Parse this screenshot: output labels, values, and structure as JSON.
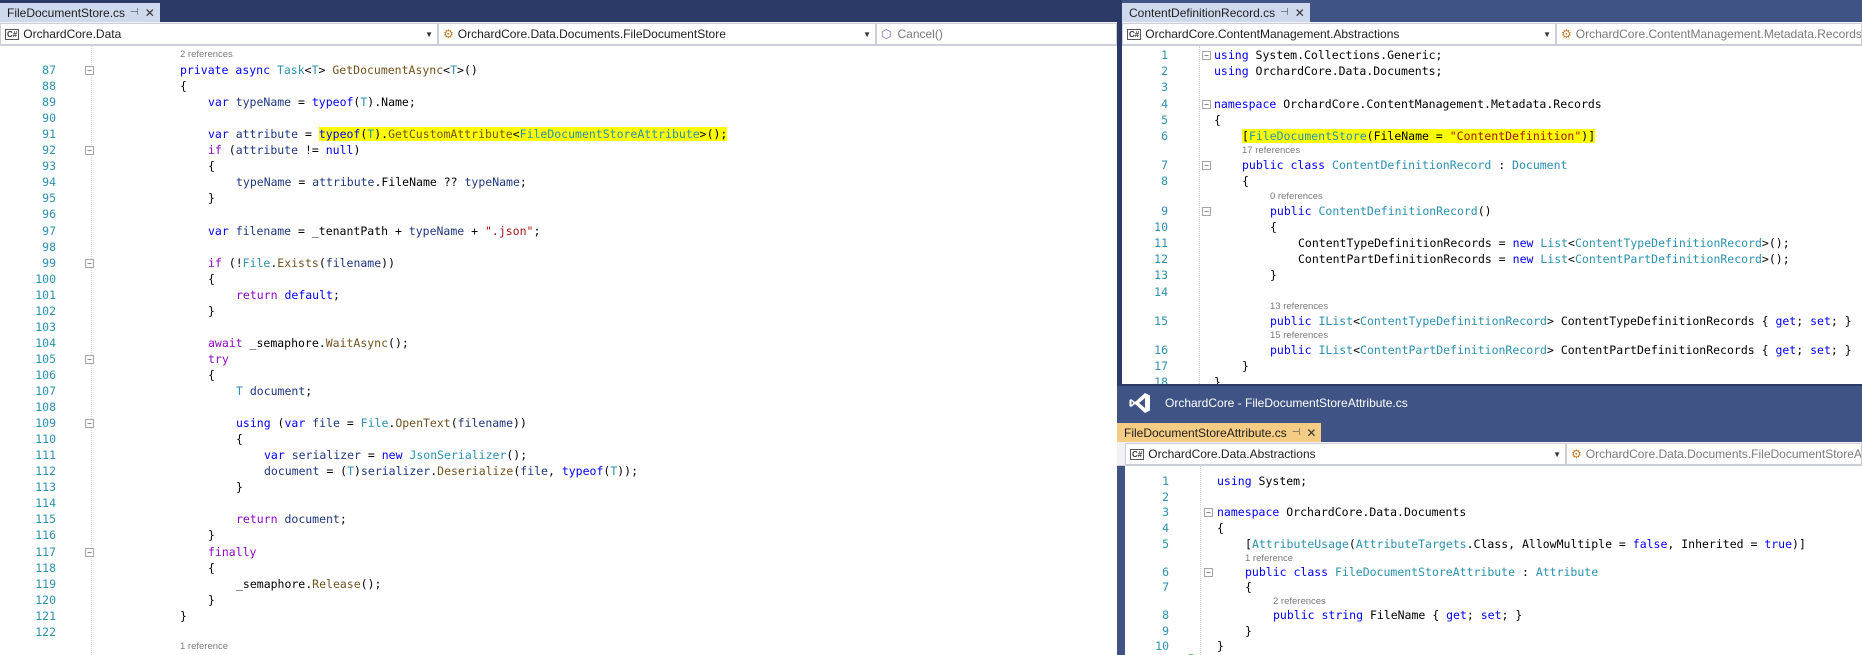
{
  "left": {
    "tab": {
      "label": "FileDocumentStore.cs"
    },
    "nav": {
      "project": "OrchardCore.Data",
      "type": "OrchardCore.Data.Documents.FileDocumentStore",
      "member": "Cancel()"
    },
    "lines": [
      {
        "ref": "2 references"
      },
      {
        "n": "87",
        "fold": "-",
        "ind": 1,
        "t": [
          [
            "kw",
            "private "
          ],
          [
            "kw",
            "async "
          ],
          [
            "ty",
            "Task"
          ],
          [
            "",
            "<"
          ],
          [
            "ty",
            "T"
          ],
          [
            "",
            "> "
          ],
          [
            "mth",
            "GetDocumentAsync"
          ],
          [
            "",
            "<"
          ],
          [
            "ty",
            "T"
          ],
          [
            "",
            ">()"
          ]
        ]
      },
      {
        "n": "88",
        "ind": 1,
        "t": [
          [
            "",
            "{"
          ]
        ]
      },
      {
        "n": "89",
        "ind": 2,
        "t": [
          [
            "kw",
            "var "
          ],
          [
            "prm",
            "typeName"
          ],
          [
            "",
            " = "
          ],
          [
            "kw",
            "typeof"
          ],
          [
            "",
            "("
          ],
          [
            "ty",
            "T"
          ],
          [
            "",
            ").Name;"
          ]
        ]
      },
      {
        "n": "90"
      },
      {
        "n": "91",
        "ind": 2,
        "t": [
          [
            "kw",
            "var "
          ],
          [
            "prm",
            "attribute"
          ],
          [
            "",
            " = "
          ],
          [
            "kw yl",
            "typeof"
          ],
          [
            "yl",
            "("
          ],
          [
            "ty yl",
            "T"
          ],
          [
            "yl",
            ")."
          ],
          [
            "mth yl",
            "GetCustomAttribute"
          ],
          [
            "yl",
            "<"
          ],
          [
            "ty yl",
            "FileDocumentStoreAttribute"
          ],
          [
            "yl",
            ">();"
          ]
        ]
      },
      {
        "n": "92",
        "fold": "-",
        "ind": 2,
        "t": [
          [
            "ctl",
            "if "
          ],
          [
            "",
            "("
          ],
          [
            "prm",
            "attribute"
          ],
          [
            "",
            " != "
          ],
          [
            "kw",
            "null"
          ],
          [
            "",
            ")"
          ]
        ]
      },
      {
        "n": "93",
        "ind": 2,
        "t": [
          [
            "",
            "{"
          ]
        ]
      },
      {
        "n": "94",
        "ind": 3,
        "t": [
          [
            "prm",
            "typeName"
          ],
          [
            "",
            " = "
          ],
          [
            "prm",
            "attribute"
          ],
          [
            "",
            ".FileName ?? "
          ],
          [
            "prm",
            "typeName"
          ],
          [
            "",
            ";"
          ]
        ]
      },
      {
        "n": "95",
        "ind": 2,
        "t": [
          [
            "",
            "}"
          ]
        ]
      },
      {
        "n": "96"
      },
      {
        "n": "97",
        "ind": 2,
        "t": [
          [
            "kw",
            "var "
          ],
          [
            "prm",
            "filename"
          ],
          [
            "",
            " = _tenantPath + "
          ],
          [
            "prm",
            "typeName"
          ],
          [
            "",
            " + "
          ],
          [
            "st",
            "\".json\""
          ],
          [
            "",
            ";"
          ]
        ]
      },
      {
        "n": "98"
      },
      {
        "n": "99",
        "fold": "-",
        "ind": 2,
        "t": [
          [
            "ctl",
            "if "
          ],
          [
            "",
            "(!"
          ],
          [
            "ty",
            "File"
          ],
          [
            "",
            "."
          ],
          [
            "mth",
            "Exists"
          ],
          [
            "",
            "("
          ],
          [
            "prm",
            "filename"
          ],
          [
            "",
            "))"
          ]
        ]
      },
      {
        "n": "100",
        "ind": 2,
        "t": [
          [
            "",
            "{"
          ]
        ]
      },
      {
        "n": "101",
        "ind": 3,
        "t": [
          [
            "ctl",
            "return "
          ],
          [
            "kw",
            "default"
          ],
          [
            "",
            ";"
          ]
        ]
      },
      {
        "n": "102",
        "ind": 2,
        "t": [
          [
            "",
            "}"
          ]
        ]
      },
      {
        "n": "103"
      },
      {
        "n": "104",
        "ind": 2,
        "t": [
          [
            "ctl",
            "await "
          ],
          [
            "",
            "_semaphore."
          ],
          [
            "mth",
            "WaitAsync"
          ],
          [
            "",
            "();"
          ]
        ]
      },
      {
        "n": "105",
        "fold": "-",
        "ind": 2,
        "t": [
          [
            "ctl",
            "try"
          ]
        ]
      },
      {
        "n": "106",
        "ind": 2,
        "t": [
          [
            "",
            "{"
          ]
        ]
      },
      {
        "n": "107",
        "ind": 3,
        "t": [
          [
            "ty",
            "T "
          ],
          [
            "prm",
            "document"
          ],
          [
            "",
            ";"
          ]
        ]
      },
      {
        "n": "108"
      },
      {
        "n": "109",
        "fold": "-",
        "ind": 3,
        "t": [
          [
            "kw",
            "using "
          ],
          [
            "",
            "("
          ],
          [
            "kw",
            "var "
          ],
          [
            "prm",
            "file"
          ],
          [
            "",
            " = "
          ],
          [
            "ty",
            "File"
          ],
          [
            "",
            "."
          ],
          [
            "mth",
            "OpenText"
          ],
          [
            "",
            "("
          ],
          [
            "prm",
            "filename"
          ],
          [
            "",
            "))"
          ]
        ]
      },
      {
        "n": "110",
        "ind": 3,
        "t": [
          [
            "",
            "{"
          ]
        ]
      },
      {
        "n": "111",
        "ind": 4,
        "t": [
          [
            "kw",
            "var "
          ],
          [
            "prm",
            "serializer"
          ],
          [
            "",
            " = "
          ],
          [
            "kw",
            "new "
          ],
          [
            "ty",
            "JsonSerializer"
          ],
          [
            "",
            "();"
          ]
        ]
      },
      {
        "n": "112",
        "ind": 4,
        "t": [
          [
            "prm",
            "document"
          ],
          [
            "",
            " = ("
          ],
          [
            "ty",
            "T"
          ],
          [
            "",
            ")"
          ],
          [
            "prm",
            "serializer"
          ],
          [
            "",
            "."
          ],
          [
            "mth",
            "Deserialize"
          ],
          [
            "",
            "("
          ],
          [
            "prm",
            "file"
          ],
          [
            "",
            ", "
          ],
          [
            "kw",
            "typeof"
          ],
          [
            "",
            "("
          ],
          [
            "ty",
            "T"
          ],
          [
            "",
            "));"
          ]
        ]
      },
      {
        "n": "113",
        "ind": 3,
        "t": [
          [
            "",
            "}"
          ]
        ]
      },
      {
        "n": "114"
      },
      {
        "n": "115",
        "ind": 3,
        "t": [
          [
            "ctl",
            "return "
          ],
          [
            "prm",
            "document"
          ],
          [
            "",
            ";"
          ]
        ]
      },
      {
        "n": "116",
        "ind": 2,
        "t": [
          [
            "",
            "}"
          ]
        ]
      },
      {
        "n": "117",
        "fold": "-",
        "ind": 2,
        "t": [
          [
            "ctl",
            "finally"
          ]
        ]
      },
      {
        "n": "118",
        "ind": 2,
        "t": [
          [
            "",
            "{"
          ]
        ]
      },
      {
        "n": "119",
        "ind": 3,
        "t": [
          [
            "",
            "_semaphore."
          ],
          [
            "mth",
            "Release"
          ],
          [
            "",
            "();"
          ]
        ]
      },
      {
        "n": "120",
        "ind": 2,
        "t": [
          [
            "",
            "}"
          ]
        ]
      },
      {
        "n": "121",
        "ind": 1,
        "t": [
          [
            "",
            "}"
          ]
        ]
      },
      {
        "n": "122"
      },
      {
        "ref": "1 reference"
      }
    ]
  },
  "topright": {
    "tab": {
      "label": "ContentDefinitionRecord.cs"
    },
    "nav": {
      "project": "OrchardCore.ContentManagement.Abstractions",
      "type": "OrchardCore.ContentManagement.Metadata.Records"
    },
    "lines": [
      {
        "n": "1",
        "fold": "-",
        "ind": 0,
        "t": [
          [
            "kw",
            "using "
          ],
          [
            "",
            "System.Collections.Generic;"
          ]
        ]
      },
      {
        "n": "2",
        "ind": 0,
        "t": [
          [
            "kw",
            "using "
          ],
          [
            "",
            "OrchardCore.Data.Documents;"
          ]
        ]
      },
      {
        "n": "3"
      },
      {
        "n": "4",
        "fold": "-",
        "ind": 0,
        "t": [
          [
            "kw",
            "namespace "
          ],
          [
            "",
            "OrchardCore.ContentManagement.Metadata.Records"
          ]
        ]
      },
      {
        "n": "5",
        "ind": 0,
        "t": [
          [
            "",
            "{"
          ]
        ]
      },
      {
        "n": "6",
        "ind": 1,
        "t": [
          [
            "yl",
            "["
          ],
          [
            "ty yl",
            "FileDocumentStore"
          ],
          [
            "yl",
            "(FileName = "
          ],
          [
            "st yl",
            "\"ContentDefinition\""
          ],
          [
            "yl",
            ")]"
          ]
        ]
      },
      {
        "ref": "17 references",
        "ind": 1
      },
      {
        "n": "7",
        "fold": "-",
        "ind": 1,
        "t": [
          [
            "kw",
            "public "
          ],
          [
            "kw",
            "class "
          ],
          [
            "ty",
            "ContentDefinitionRecord"
          ],
          [
            "",
            " : "
          ],
          [
            "ty",
            "Document"
          ]
        ]
      },
      {
        "n": "8",
        "ind": 1,
        "t": [
          [
            "",
            "{"
          ]
        ]
      },
      {
        "ref": "0 references",
        "ind": 2
      },
      {
        "n": "9",
        "fold": "-",
        "ind": 2,
        "t": [
          [
            "kw",
            "public "
          ],
          [
            "ty",
            "ContentDefinitionRecord"
          ],
          [
            "",
            "()"
          ]
        ]
      },
      {
        "n": "10",
        "ind": 2,
        "t": [
          [
            "",
            "{"
          ]
        ]
      },
      {
        "n": "11",
        "ind": 3,
        "t": [
          [
            "",
            "ContentTypeDefinitionRecords = "
          ],
          [
            "kw",
            "new "
          ],
          [
            "ty",
            "List"
          ],
          [
            "",
            "<"
          ],
          [
            "ty",
            "ContentTypeDefinitionRecord"
          ],
          [
            "",
            ">();"
          ]
        ]
      },
      {
        "n": "12",
        "ind": 3,
        "t": [
          [
            "",
            "ContentPartDefinitionRecords = "
          ],
          [
            "kw",
            "new "
          ],
          [
            "ty",
            "List"
          ],
          [
            "",
            "<"
          ],
          [
            "ty",
            "ContentPartDefinitionRecord"
          ],
          [
            "",
            ">();"
          ]
        ]
      },
      {
        "n": "13",
        "ind": 2,
        "t": [
          [
            "",
            "}"
          ]
        ]
      },
      {
        "n": "14"
      },
      {
        "ref": "13 references",
        "ind": 2
      },
      {
        "n": "15",
        "ind": 2,
        "t": [
          [
            "kw",
            "public "
          ],
          [
            "ty",
            "IList"
          ],
          [
            "",
            "<"
          ],
          [
            "ty",
            "ContentTypeDefinitionRecord"
          ],
          [
            "",
            "> ContentTypeDefinitionRecords { "
          ],
          [
            "kw",
            "get"
          ],
          [
            "",
            "; "
          ],
          [
            "kw",
            "set"
          ],
          [
            "",
            "; }"
          ]
        ]
      },
      {
        "ref": "15 references",
        "ind": 2
      },
      {
        "n": "16",
        "ind": 2,
        "t": [
          [
            "kw",
            "public "
          ],
          [
            "ty",
            "IList"
          ],
          [
            "",
            "<"
          ],
          [
            "ty",
            "ContentPartDefinitionRecord"
          ],
          [
            "",
            "> ContentPartDefinitionRecords { "
          ],
          [
            "kw",
            "get"
          ],
          [
            "",
            "; "
          ],
          [
            "kw",
            "set"
          ],
          [
            "",
            "; }"
          ]
        ]
      },
      {
        "n": "17",
        "ind": 1,
        "t": [
          [
            "",
            "}"
          ]
        ]
      },
      {
        "n": "18",
        "ind": 0,
        "t": [
          [
            "",
            "}"
          ]
        ]
      }
    ]
  },
  "bottomright": {
    "window_title": "OrchardCore - FileDocumentStoreAttribute.cs",
    "tab": {
      "label": "FileDocumentStoreAttribute.cs"
    },
    "nav": {
      "project": "OrchardCore.Data.Abstractions",
      "type": "OrchardCore.Data.Documents.FileDocumentStoreAttribute"
    },
    "lines": [
      {
        "n": "1",
        "ind": 0,
        "t": [
          [
            "kw",
            "using "
          ],
          [
            "",
            "System;"
          ]
        ]
      },
      {
        "n": "2"
      },
      {
        "n": "3",
        "fold": "-",
        "ind": 0,
        "t": [
          [
            "kw",
            "namespace "
          ],
          [
            "",
            "OrchardCore.Data.Documents"
          ]
        ]
      },
      {
        "n": "4",
        "ind": 0,
        "t": [
          [
            "",
            "{"
          ]
        ]
      },
      {
        "n": "5",
        "ind": 1,
        "t": [
          [
            "",
            "["
          ],
          [
            "ty",
            "AttributeUsage"
          ],
          [
            "",
            "("
          ],
          [
            "ty",
            "AttributeTargets"
          ],
          [
            "",
            ".Class, AllowMultiple = "
          ],
          [
            "kw",
            "false"
          ],
          [
            "",
            ", Inherited = "
          ],
          [
            "kw",
            "true"
          ],
          [
            "",
            ")]"
          ]
        ]
      },
      {
        "ref": "1 reference",
        "ind": 1
      },
      {
        "n": "6",
        "fold": "-",
        "ind": 1,
        "t": [
          [
            "kw",
            "public "
          ],
          [
            "kw",
            "class "
          ],
          [
            "ty",
            "FileDocumentStoreAttribute"
          ],
          [
            "",
            " : "
          ],
          [
            "ty",
            "Attribute"
          ]
        ]
      },
      {
        "n": "7",
        "ind": 1,
        "t": [
          [
            "",
            "{"
          ]
        ]
      },
      {
        "ref": "2 references",
        "ind": 2
      },
      {
        "n": "8",
        "ind": 2,
        "t": [
          [
            "kw",
            "public "
          ],
          [
            "kw",
            "string "
          ],
          [
            "",
            "FileName { "
          ],
          [
            "kw",
            "get"
          ],
          [
            "",
            "; "
          ],
          [
            "kw",
            "set"
          ],
          [
            "",
            "; }"
          ]
        ]
      },
      {
        "n": "9",
        "ind": 1,
        "t": [
          [
            "",
            "}"
          ]
        ]
      },
      {
        "n": "10",
        "ind": 0,
        "t": [
          [
            "",
            "}"
          ]
        ]
      }
    ]
  }
}
